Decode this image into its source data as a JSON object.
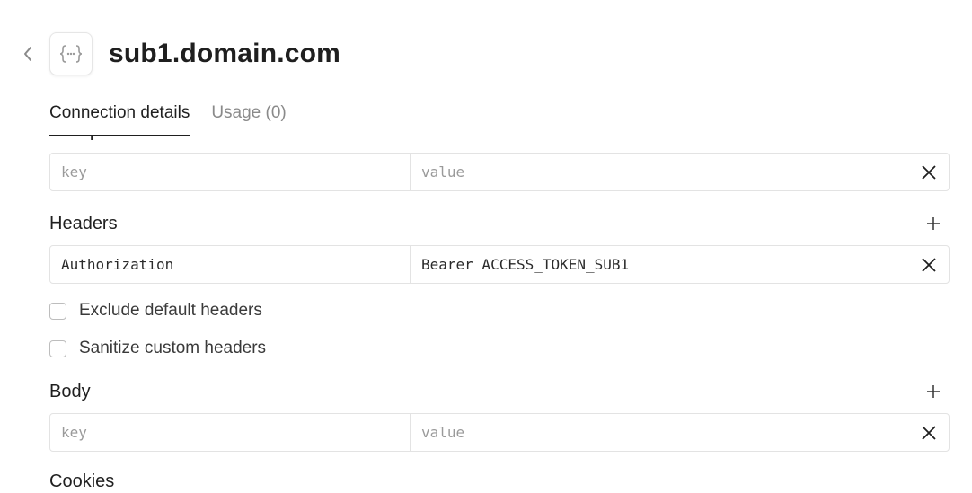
{
  "header": {
    "title": "sub1.domain.com",
    "tabs": [
      {
        "label": "Connection details",
        "active": true
      },
      {
        "label": "Usage (0)",
        "active": false
      }
    ]
  },
  "sections": {
    "url_parameters": {
      "title": "URL parameters",
      "row": {
        "key_placeholder": "key",
        "value_placeholder": "value"
      }
    },
    "headers": {
      "title": "Headers",
      "row": {
        "key": "Authorization",
        "value": "Bearer ACCESS_TOKEN_SUB1"
      }
    },
    "options": [
      {
        "label": "Exclude default headers",
        "checked": false
      },
      {
        "label": "Sanitize custom headers",
        "checked": false
      }
    ],
    "body": {
      "title": "Body",
      "row": {
        "key_placeholder": "key",
        "value_placeholder": "value"
      }
    },
    "cookies": {
      "title": "Cookies"
    }
  },
  "colors": {
    "text": "#1f1f1f",
    "muted": "#8a8a8a",
    "border": "#e3e3e3"
  },
  "icons": [
    "chevron-left-icon",
    "api-braces-icon",
    "plus-icon",
    "close-icon"
  ]
}
